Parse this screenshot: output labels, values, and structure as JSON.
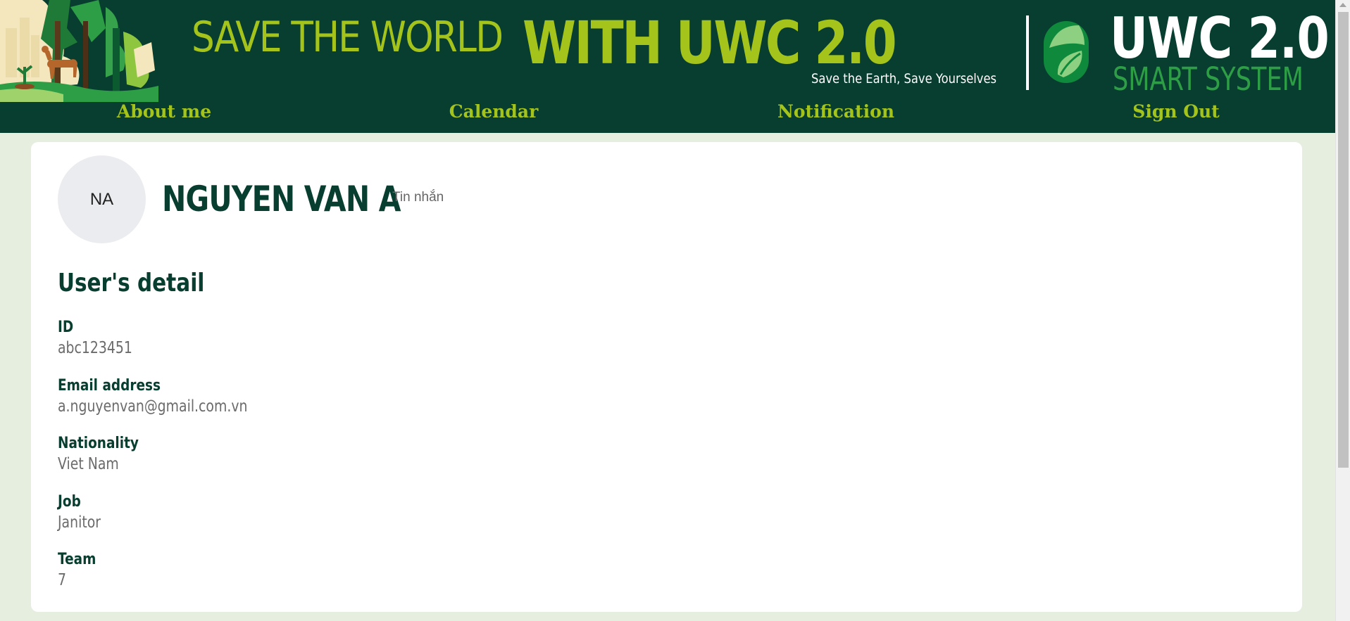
{
  "header": {
    "headline_part1": "SAVE THE WORLD",
    "headline_part2": "WITH UWC 2.0",
    "tagline": "Save the Earth, Save Yourselves",
    "brand_title": "UWC 2.0",
    "brand_subtitle": "SMART SYSTEM",
    "colors": {
      "background": "#073e2f",
      "accent": "#a4c41c",
      "brand_green": "#2e9e46"
    }
  },
  "nav": {
    "items": [
      {
        "label": "About me"
      },
      {
        "label": "Calendar"
      },
      {
        "label": "Notification"
      },
      {
        "label": "Sign Out"
      }
    ]
  },
  "profile": {
    "initials": "NA",
    "name": "NGUYEN VAN A",
    "message_link": "Tin nhắn"
  },
  "details": {
    "title": "User's detail",
    "fields": [
      {
        "label": "ID",
        "value": "abc123451"
      },
      {
        "label": "Email address",
        "value": "a.nguyenvan@gmail.com.vn"
      },
      {
        "label": "Nationality",
        "value": "Viet Nam"
      },
      {
        "label": "Job",
        "value": "Janitor"
      },
      {
        "label": "Team",
        "value": "7"
      }
    ]
  }
}
